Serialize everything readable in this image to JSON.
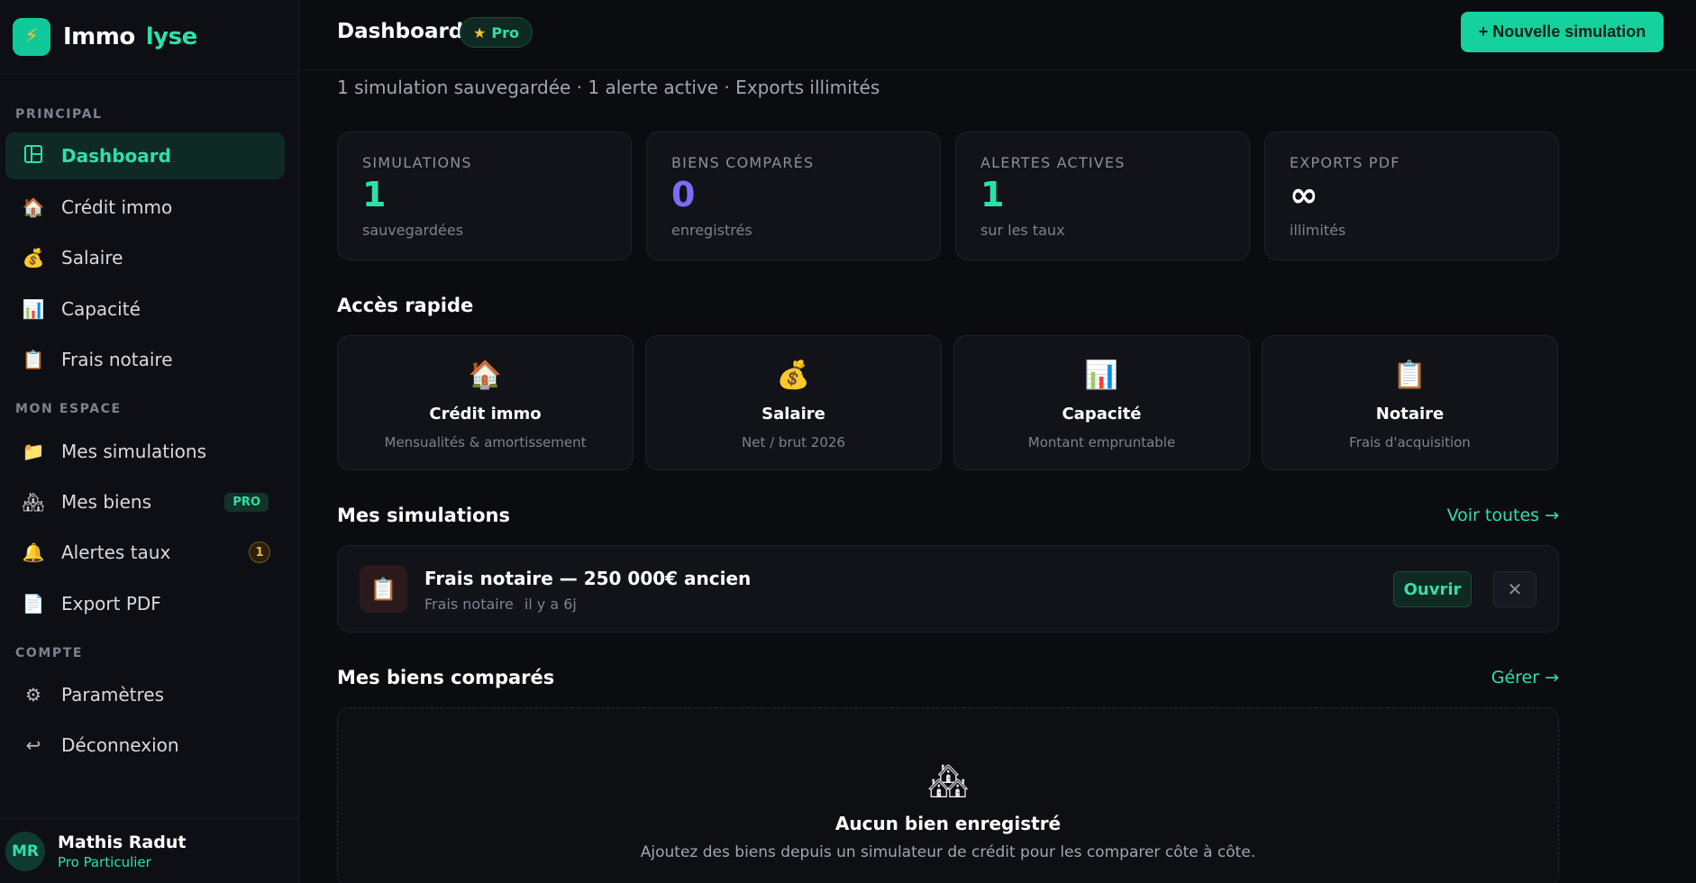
{
  "brand": {
    "name_part1": "Immo",
    "name_part2": "lyse",
    "logo_icon": "lightning-icon"
  },
  "sidebar": {
    "sections": {
      "principal": "PRINCIPAL",
      "mon_espace": "MON ESPACE",
      "compte": "COMPTE"
    },
    "items": [
      {
        "label": "Dashboard",
        "icon": "grid-icon"
      },
      {
        "label": "Crédit immo",
        "icon": "house-icon"
      },
      {
        "label": "Salaire",
        "icon": "money-bag-icon"
      },
      {
        "label": "Capacité",
        "icon": "bar-chart-icon"
      },
      {
        "label": "Frais notaire",
        "icon": "clipboard-icon"
      },
      {
        "label": "Mes simulations",
        "icon": "folder-icon"
      },
      {
        "label": "Mes biens",
        "icon": "houses-icon",
        "badge": "PRO"
      },
      {
        "label": "Alertes taux",
        "icon": "bell-icon",
        "badge": "1"
      },
      {
        "label": "Export PDF",
        "icon": "document-icon"
      },
      {
        "label": "Paramètres",
        "icon": "gear-icon"
      },
      {
        "label": "Déconnexion",
        "icon": "logout-icon"
      }
    ],
    "user": {
      "initials": "MR",
      "name": "Mathis Radut",
      "plan": "Pro Particulier"
    }
  },
  "header": {
    "title": "Dashboard",
    "plan_badge": "Pro",
    "new_simulation": "+ Nouvelle simulation",
    "subtitle": "1 simulation sauvegardée · 1 alerte active · Exports illimités"
  },
  "stats": [
    {
      "label": "SIMULATIONS",
      "value": "1",
      "sub": "sauvegardées",
      "color": "#2ee0a8"
    },
    {
      "label": "BIENS COMPARÉS",
      "value": "0",
      "sub": "enregistrés",
      "color": "#7c6cf6"
    },
    {
      "label": "ALERTES ACTIVES",
      "value": "1",
      "sub": "sur les taux",
      "color": "#2ee0a8"
    },
    {
      "label": "EXPORTS PDF",
      "value": "∞",
      "sub": "illimités",
      "color": "#ffffff"
    }
  ],
  "quick_access": {
    "title": "Accès rapide",
    "cards": [
      {
        "icon": "house-icon",
        "title": "Crédit immo",
        "desc": "Mensualités & amortissement"
      },
      {
        "icon": "money-bag-icon",
        "title": "Salaire",
        "desc": "Net / brut 2026"
      },
      {
        "icon": "bar-chart-icon",
        "title": "Capacité",
        "desc": "Montant empruntable"
      },
      {
        "icon": "clipboard-icon",
        "title": "Notaire",
        "desc": "Frais d'acquisition"
      }
    ]
  },
  "simulations": {
    "title": "Mes simulations",
    "link": "Voir toutes →",
    "items": [
      {
        "title": "Frais notaire — 250 000€ ancien",
        "type": "Frais notaire",
        "age": "il y a 6j",
        "open": "Ouvrir",
        "close": "✕"
      }
    ]
  },
  "biens": {
    "title": "Mes biens comparés",
    "link": "Gérer →",
    "empty_title": "Aucun bien enregistré",
    "empty_desc": "Ajoutez des biens depuis un simulateur de crédit pour les comparer côte à côte."
  },
  "colors": {
    "accent": "#14d19d",
    "background": "#0b0c10",
    "card": "#111318"
  }
}
